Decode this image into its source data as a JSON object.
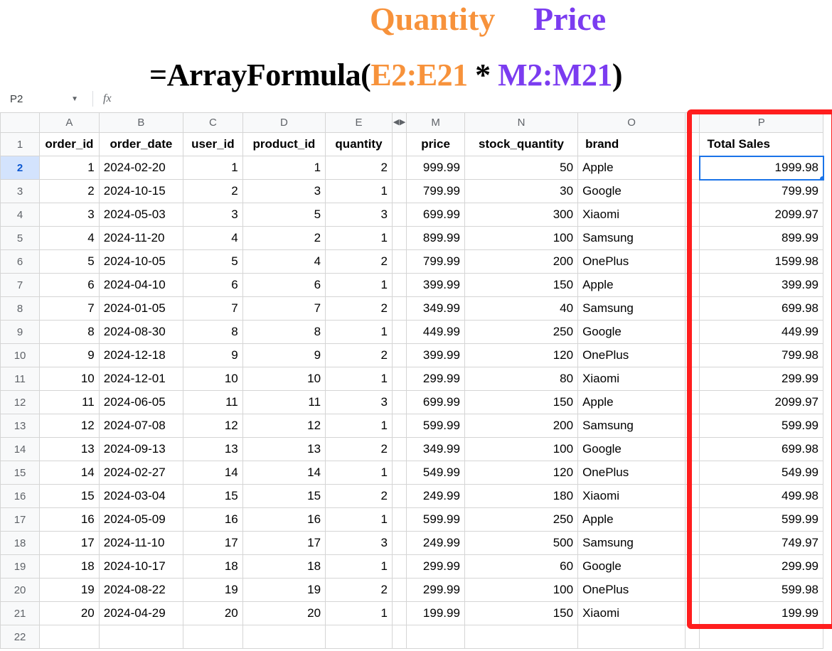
{
  "annotation": {
    "quantity_label": "Quantity",
    "price_label": "Price",
    "formula_prefix": "=ArrayFormula(",
    "formula_range1": "E2:E21",
    "formula_star": " * ",
    "formula_range2": "M2:M21",
    "formula_suffix": ")"
  },
  "namebox": {
    "cell": "P2",
    "fx_label": "fx"
  },
  "columns": {
    "row_corner": "",
    "A": "A",
    "B": "B",
    "C": "C",
    "D": "D",
    "E": "E",
    "M": "M",
    "N": "N",
    "O": "O",
    "P": "P"
  },
  "gap_arrows": {
    "left": "◀",
    "right": "▶"
  },
  "header_row": {
    "n": "1",
    "A": "order_id",
    "B": "order_date",
    "C": "user_id",
    "D": "product_id",
    "E": "quantity",
    "M": "price",
    "N": "stock_quantity",
    "O": "brand",
    "P": "Total Sales"
  },
  "rows": [
    {
      "n": "2",
      "A": "1",
      "B": "2024-02-20",
      "C": "1",
      "D": "1",
      "E": "2",
      "M": "999.99",
      "N": "50",
      "O": "Apple",
      "P": "1999.98"
    },
    {
      "n": "3",
      "A": "2",
      "B": "2024-10-15",
      "C": "2",
      "D": "3",
      "E": "1",
      "M": "799.99",
      "N": "30",
      "O": "Google",
      "P": "799.99"
    },
    {
      "n": "4",
      "A": "3",
      "B": "2024-05-03",
      "C": "3",
      "D": "5",
      "E": "3",
      "M": "699.99",
      "N": "300",
      "O": "Xiaomi",
      "P": "2099.97"
    },
    {
      "n": "5",
      "A": "4",
      "B": "2024-11-20",
      "C": "4",
      "D": "2",
      "E": "1",
      "M": "899.99",
      "N": "100",
      "O": "Samsung",
      "P": "899.99"
    },
    {
      "n": "6",
      "A": "5",
      "B": "2024-10-05",
      "C": "5",
      "D": "4",
      "E": "2",
      "M": "799.99",
      "N": "200",
      "O": "OnePlus",
      "P": "1599.98"
    },
    {
      "n": "7",
      "A": "6",
      "B": "2024-04-10",
      "C": "6",
      "D": "6",
      "E": "1",
      "M": "399.99",
      "N": "150",
      "O": "Apple",
      "P": "399.99"
    },
    {
      "n": "8",
      "A": "7",
      "B": "2024-01-05",
      "C": "7",
      "D": "7",
      "E": "2",
      "M": "349.99",
      "N": "40",
      "O": "Samsung",
      "P": "699.98"
    },
    {
      "n": "9",
      "A": "8",
      "B": "2024-08-30",
      "C": "8",
      "D": "8",
      "E": "1",
      "M": "449.99",
      "N": "250",
      "O": "Google",
      "P": "449.99"
    },
    {
      "n": "10",
      "A": "9",
      "B": "2024-12-18",
      "C": "9",
      "D": "9",
      "E": "2",
      "M": "399.99",
      "N": "120",
      "O": "OnePlus",
      "P": "799.98"
    },
    {
      "n": "11",
      "A": "10",
      "B": "2024-12-01",
      "C": "10",
      "D": "10",
      "E": "1",
      "M": "299.99",
      "N": "80",
      "O": "Xiaomi",
      "P": "299.99"
    },
    {
      "n": "12",
      "A": "11",
      "B": "2024-06-05",
      "C": "11",
      "D": "11",
      "E": "3",
      "M": "699.99",
      "N": "150",
      "O": "Apple",
      "P": "2099.97"
    },
    {
      "n": "13",
      "A": "12",
      "B": "2024-07-08",
      "C": "12",
      "D": "12",
      "E": "1",
      "M": "599.99",
      "N": "200",
      "O": "Samsung",
      "P": "599.99"
    },
    {
      "n": "14",
      "A": "13",
      "B": "2024-09-13",
      "C": "13",
      "D": "13",
      "E": "2",
      "M": "349.99",
      "N": "100",
      "O": "Google",
      "P": "699.98"
    },
    {
      "n": "15",
      "A": "14",
      "B": "2024-02-27",
      "C": "14",
      "D": "14",
      "E": "1",
      "M": "549.99",
      "N": "120",
      "O": "OnePlus",
      "P": "549.99"
    },
    {
      "n": "16",
      "A": "15",
      "B": "2024-03-04",
      "C": "15",
      "D": "15",
      "E": "2",
      "M": "249.99",
      "N": "180",
      "O": "Xiaomi",
      "P": "499.98"
    },
    {
      "n": "17",
      "A": "16",
      "B": "2024-05-09",
      "C": "16",
      "D": "16",
      "E": "1",
      "M": "599.99",
      "N": "250",
      "O": "Apple",
      "P": "599.99"
    },
    {
      "n": "18",
      "A": "17",
      "B": "2024-11-10",
      "C": "17",
      "D": "17",
      "E": "3",
      "M": "249.99",
      "N": "500",
      "O": "Samsung",
      "P": "749.97"
    },
    {
      "n": "19",
      "A": "18",
      "B": "2024-10-17",
      "C": "18",
      "D": "18",
      "E": "1",
      "M": "299.99",
      "N": "60",
      "O": "Google",
      "P": "299.99"
    },
    {
      "n": "20",
      "A": "19",
      "B": "2024-08-22",
      "C": "19",
      "D": "19",
      "E": "2",
      "M": "299.99",
      "N": "100",
      "O": "OnePlus",
      "P": "599.98"
    },
    {
      "n": "21",
      "A": "20",
      "B": "2024-04-29",
      "C": "20",
      "D": "20",
      "E": "1",
      "M": "199.99",
      "N": "150",
      "O": "Xiaomi",
      "P": "199.99"
    }
  ],
  "empty_row": {
    "n": "22"
  }
}
